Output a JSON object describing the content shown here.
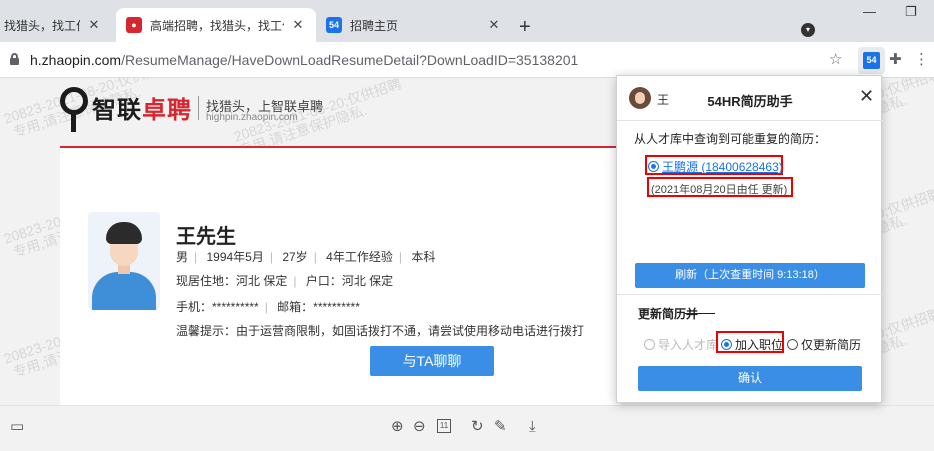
{
  "tabs": [
    {
      "title": "找猎头，找工作-智联",
      "close": "✕"
    },
    {
      "title": "高端招聘，找猎头，找工作-智联",
      "close": "✕"
    },
    {
      "title": "招聘主页",
      "close": "✕",
      "icon_text": "54"
    }
  ],
  "new_tab": "+",
  "window_controls": {
    "minimize": "—",
    "restore": "❐"
  },
  "address": {
    "host": "h.zhaopin.com",
    "path": "/ResumeManage/HaveDownLoadResumeDetail?DownLoadID=35138201"
  },
  "extension_icon_text": "54",
  "brand": {
    "logo_part1": "智联",
    "logo_part2": "卓聘",
    "slogan": "找猎头，上智联卓聘",
    "site": "highpin.zhaopin.com"
  },
  "watermarks": {
    "line1": "20823-2021-08-20;仅供招聘",
    "line2": "专用,请注意保护隐私."
  },
  "resume": {
    "name": "王先生",
    "gender": "男",
    "birth": "1994年5月",
    "age": "27岁",
    "experience": "4年工作经验",
    "education": "本科",
    "residence": "现居住地：河北 保定",
    "hukou": "户口：河北 保定",
    "phone": "手机：**********",
    "email": "邮箱：**********",
    "tip": "温馨提示：由于运营商限制，如固话拨打不通，请尝试使用移动电话进行拨打",
    "chat_button": "与TA聊聊"
  },
  "popup": {
    "user": "王",
    "title": "54HR简历助手",
    "close": "✕",
    "label": "从人才库中查询到可能重复的简历：",
    "match": "王鹏源 (18400628463)",
    "match_date": "(2021年08月20日由任   更新)",
    "refresh_button": "刷新（上次查重时间 9:13:18）",
    "update_label": "更新简历并",
    "options": [
      "导入人才库",
      "加入职位",
      "仅更新简历"
    ],
    "confirm_button": "确认"
  },
  "colors": {
    "brand_red": "#d6262f",
    "button_blue": "#3a8ee6",
    "highlight_red": "#e00000",
    "link_blue": "#1a73e8"
  }
}
